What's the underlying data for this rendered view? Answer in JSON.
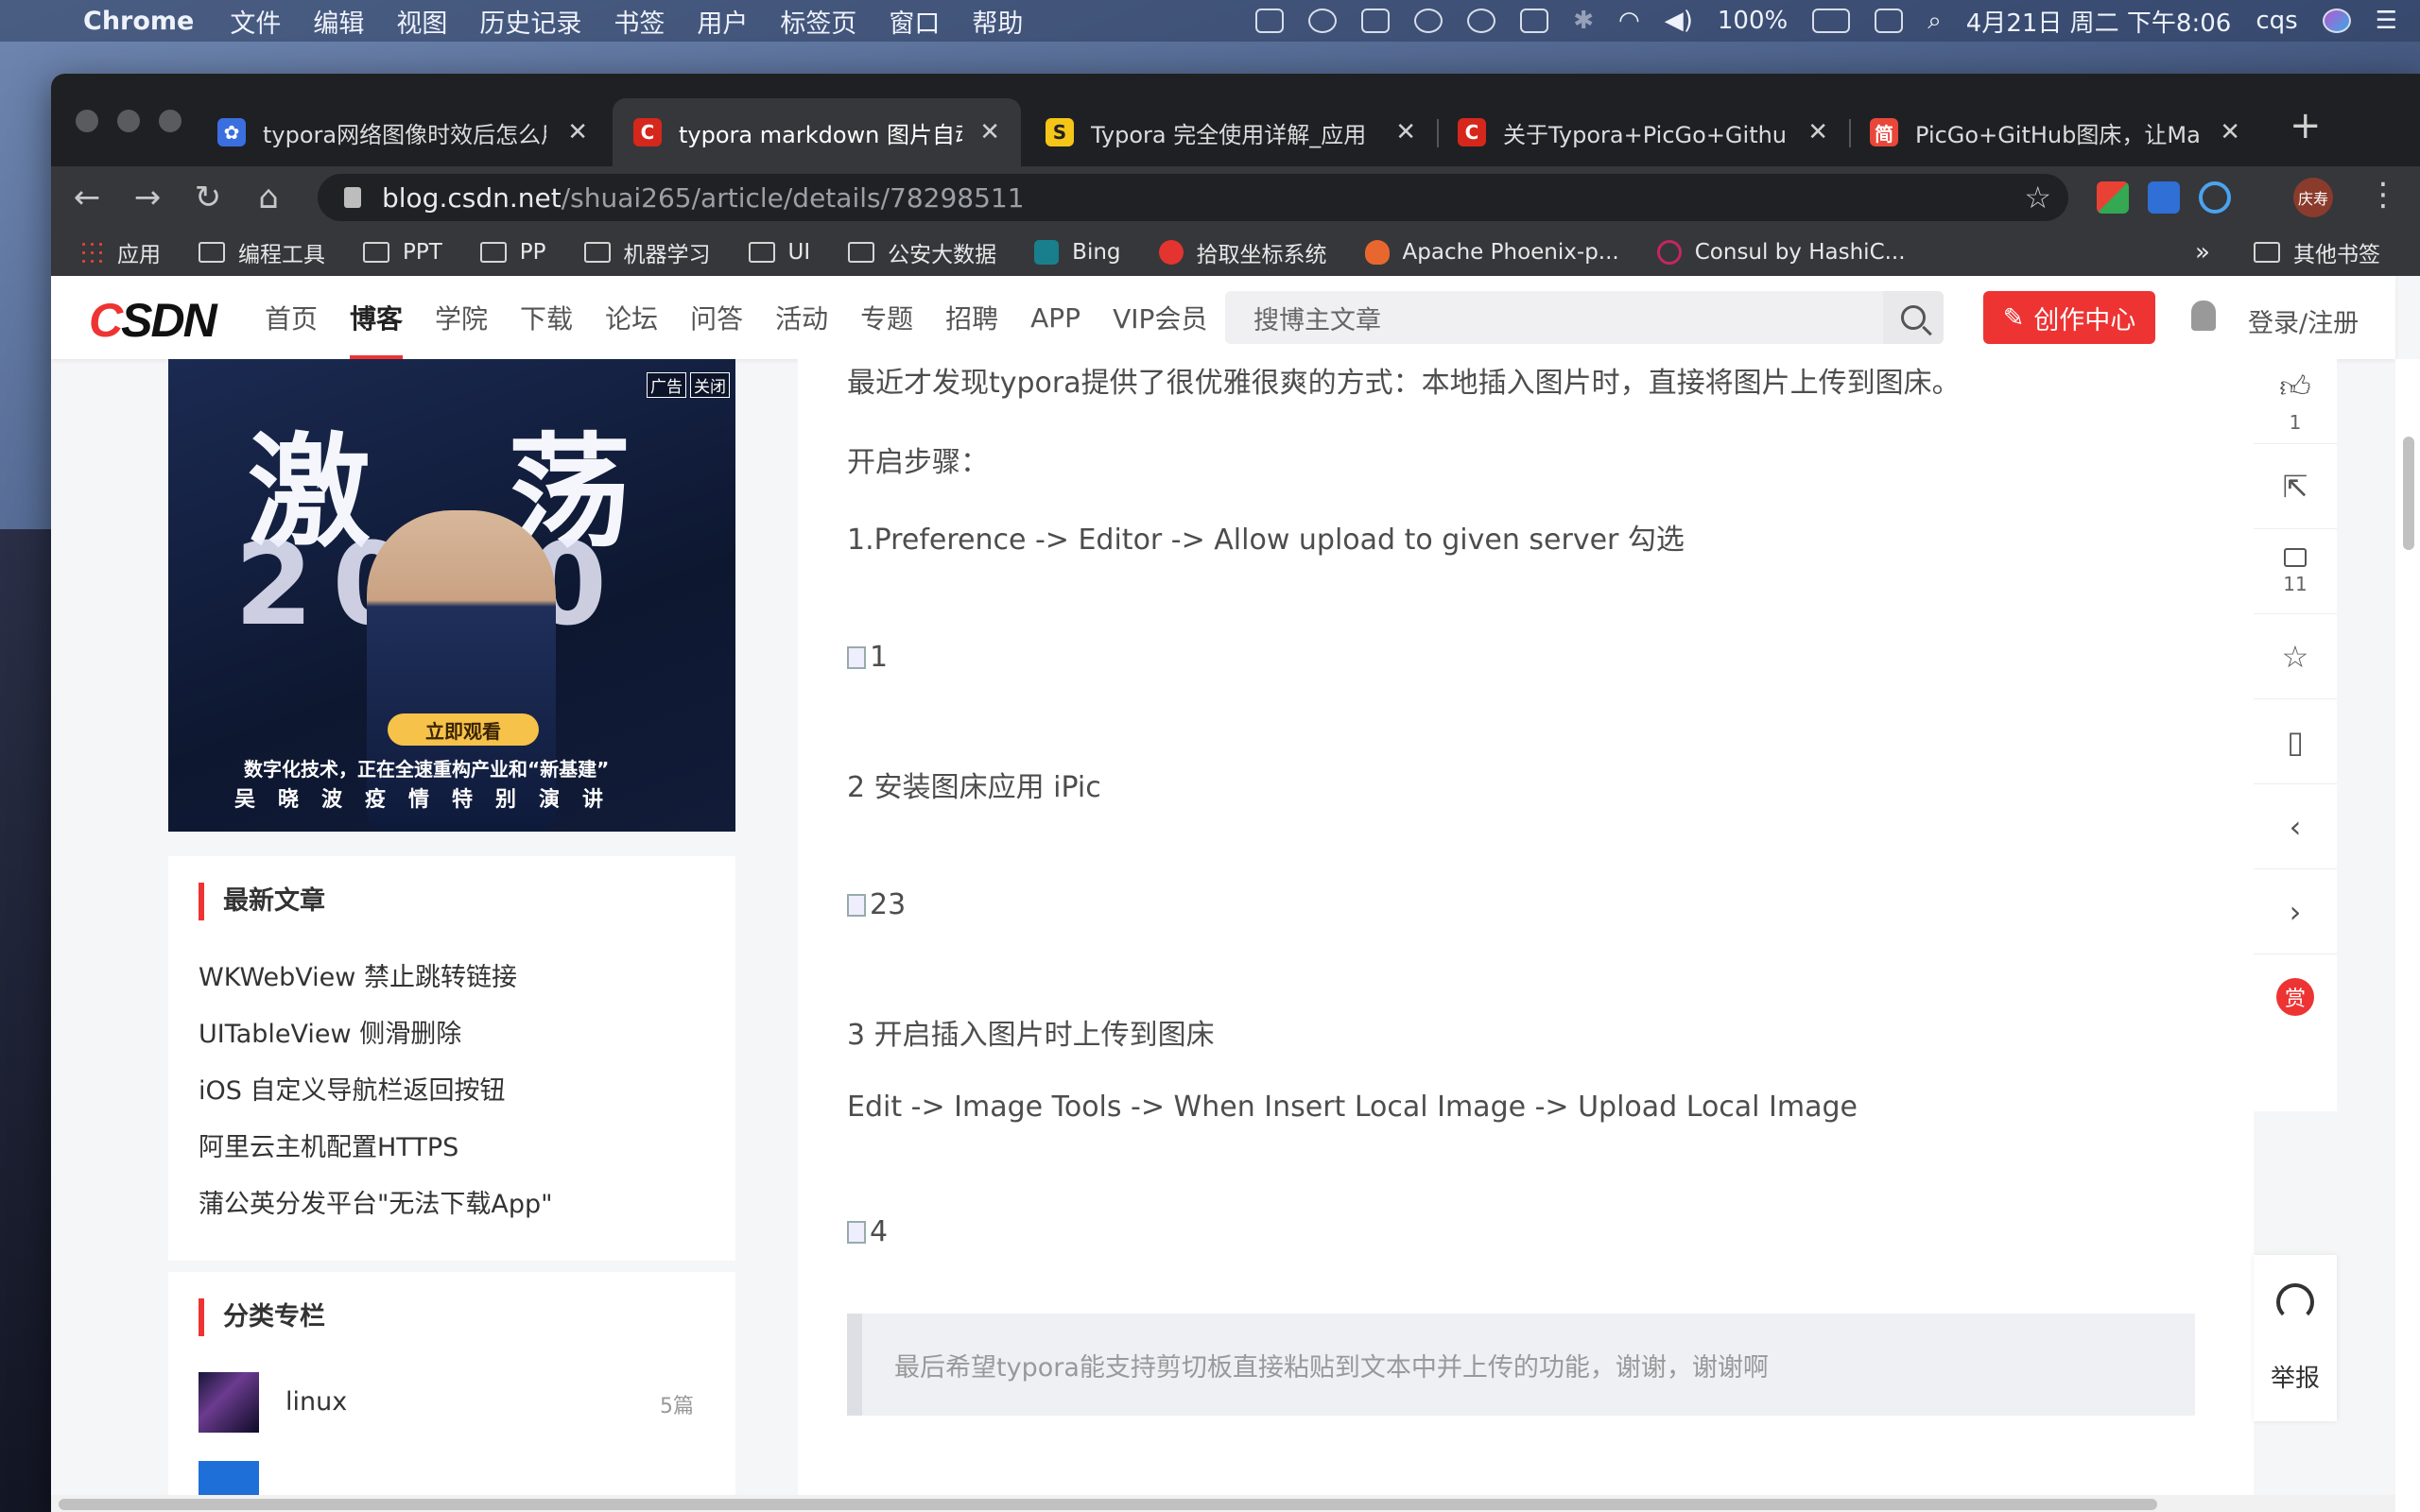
{
  "menubar": {
    "app": "Chrome",
    "items": [
      "文件",
      "编辑",
      "视图",
      "历史记录",
      "书签",
      "用户",
      "标签页",
      "窗口",
      "帮助"
    ],
    "battery": "100%",
    "datetime": "4月21日 周二 下午8:06",
    "user": "cqs"
  },
  "tabs": [
    {
      "title": "typora网络图像时效后怎么用",
      "color": "#3b6fe0",
      "glyph": "✿"
    },
    {
      "title": "typora markdown 图片自动上传",
      "color": "#d6271c",
      "glyph": "C"
    },
    {
      "title": "Typora 完全使用详解_应用",
      "color": "#f5c518",
      "glyph": "S"
    },
    {
      "title": "关于Typora+PicGo+Github",
      "color": "#d6271c",
      "glyph": "C"
    },
    {
      "title": "PicGo+GitHub图床，让Mar",
      "color": "#e9473a",
      "glyph": "简"
    }
  ],
  "address": {
    "host": "blog.csdn.net",
    "path": "/shuai265/article/details/78298511"
  },
  "profile": "庆寿",
  "bookmarks": [
    {
      "label": "应用",
      "kind": "apps"
    },
    {
      "label": "编程工具",
      "kind": "folder"
    },
    {
      "label": "PPT",
      "kind": "folder"
    },
    {
      "label": "PP",
      "kind": "folder"
    },
    {
      "label": "机器学习",
      "kind": "folder"
    },
    {
      "label": "UI",
      "kind": "folder"
    },
    {
      "label": "公安大数据",
      "kind": "folder"
    },
    {
      "label": "Bing",
      "kind": "site",
      "color": "#1a7f8c"
    },
    {
      "label": "拾取坐标系统",
      "kind": "site",
      "color": "#e3342f"
    },
    {
      "label": "Apache Phoenix-p...",
      "kind": "site",
      "color": "#e8672e"
    },
    {
      "label": "Consul by HashiC...",
      "kind": "site",
      "color": "#c5265f"
    }
  ],
  "bookmarks_other": "其他书签",
  "csdn": {
    "logo_c": "C",
    "logo_rest": "SDN",
    "nav": [
      "首页",
      "博客",
      "学院",
      "下载",
      "论坛",
      "问答",
      "活动",
      "专题",
      "招聘",
      "APP",
      "VIP会员"
    ],
    "nav_active": "博客",
    "search_placeholder": "搜博主文章",
    "create": "创作中心",
    "login": "登录/注册"
  },
  "ad": {
    "title": "激 荡",
    "year": "2020",
    "button": "立即观看",
    "line1": "数字化技术，正在全速重构产业和“新基建”",
    "line2": "吴晓波疫情特别演讲",
    "tag1": "广告",
    "tag2": "关闭"
  },
  "latest": {
    "heading": "最新文章",
    "items": [
      "WKWebView 禁止跳转链接",
      "UITableView 侧滑删除",
      "iOS 自定义导航栏返回按钮",
      "阿里云主机配置HTTPS",
      "蒲公英分发平台\"无法下载App\""
    ]
  },
  "categories": {
    "heading": "分类专栏",
    "items": [
      {
        "name": "linux",
        "count": "5篇"
      }
    ]
  },
  "article": {
    "intro": "最近才发现typora提供了很优雅很爽的方式：本地插入图片时，直接将图片上传到图床。",
    "steps_label": "开启步骤：",
    "step1": "1.Preference -> Editor -> Allow upload to given server 勾选",
    "img1": "1",
    "step2": "2 安装图床应用 iPic",
    "img2": "23",
    "step3": "3 开启插入图片时上传到图床",
    "step3_detail": "Edit -> Image Tools -> When Insert Local Image -> Upload Local Image",
    "img3": "4",
    "quote": "最后希望typora能支持剪切板直接粘贴到文本中并上传的功能，谢谢，谢谢啊"
  },
  "rail": {
    "likes": "1",
    "comments": "11",
    "reward": "赏",
    "report": "举报"
  }
}
